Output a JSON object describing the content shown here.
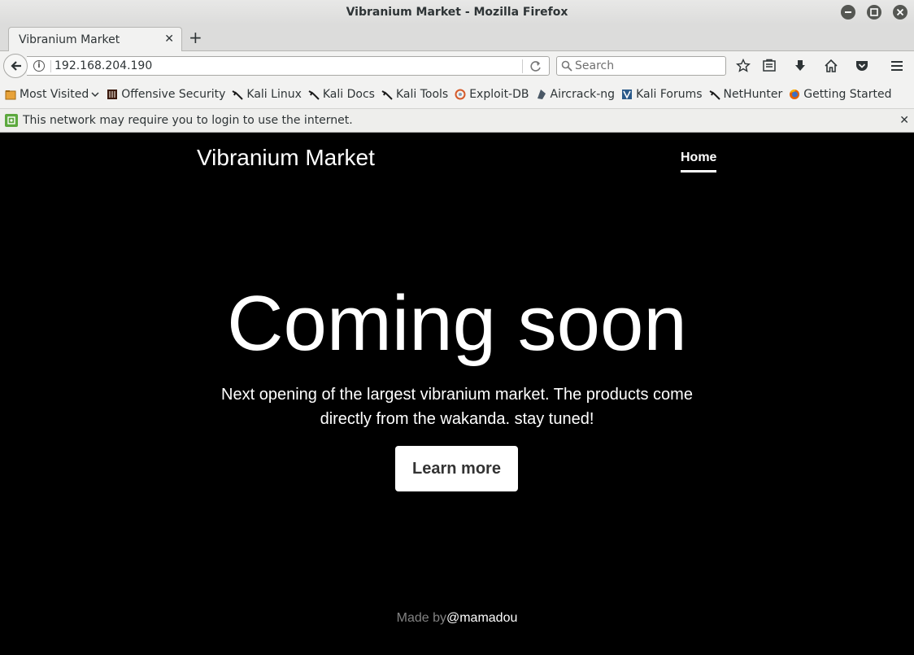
{
  "window": {
    "title": "Vibranium Market - Mozilla Firefox"
  },
  "tabs": [
    {
      "label": "Vibranium Market"
    }
  ],
  "navbar": {
    "url": "192.168.204.190",
    "search_placeholder": "Search"
  },
  "bookmarks": [
    {
      "label": "Most Visited",
      "icon": "folder-icon"
    },
    {
      "label": "Offensive Security",
      "icon": "offsec-icon"
    },
    {
      "label": "Kali Linux",
      "icon": "kali-dragon-icon"
    },
    {
      "label": "Kali Docs",
      "icon": "kali-dragon-icon"
    },
    {
      "label": "Kali Tools",
      "icon": "kali-dragon-icon"
    },
    {
      "label": "Exploit-DB",
      "icon": "exploitdb-icon"
    },
    {
      "label": "Aircrack-ng",
      "icon": "aircrack-icon"
    },
    {
      "label": "Kali Forums",
      "icon": "kali-forums-icon"
    },
    {
      "label": "NetHunter",
      "icon": "kali-dragon-icon"
    },
    {
      "label": "Getting Started",
      "icon": "firefox-icon"
    }
  ],
  "notification": {
    "text": "This network may require you to login to use the internet."
  },
  "page": {
    "brand": "Vibranium Market",
    "nav_home": "Home",
    "hero_title": "Coming soon",
    "lead": "Next opening of the largest vibranium market. The products come directly from the wakanda. stay tuned!",
    "cta": "Learn more",
    "footer_prefix": "Made by",
    "footer_author": "@mamadou"
  },
  "colors": {
    "page_bg": "#000000",
    "chrome_bg": "#f2f2f1",
    "notify_icon": "#5ca83e"
  }
}
